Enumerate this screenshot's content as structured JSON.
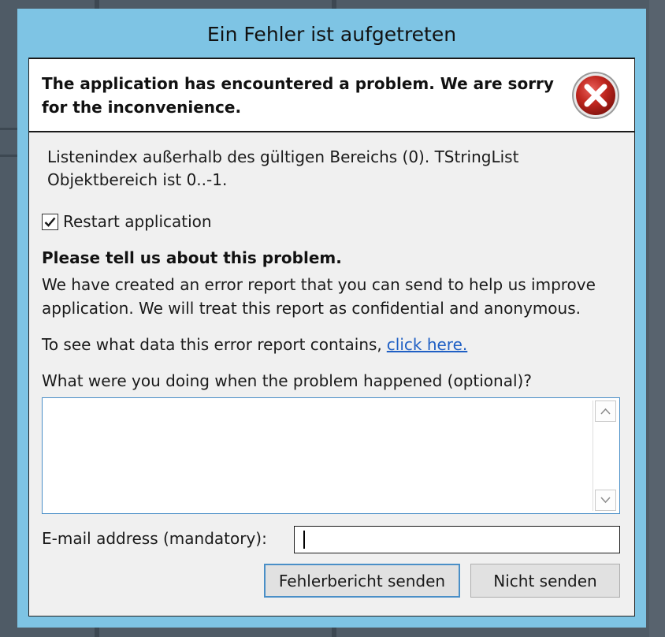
{
  "window": {
    "title": "Ein Fehler ist aufgetreten"
  },
  "header": {
    "text": "The application has encountered a problem. We are sorry for the inconvenience.",
    "icon": "error-icon"
  },
  "message": "Listenindex außerhalb des gültigen Bereichs (0). TStringList Objektbereich ist 0..-1.",
  "restart": {
    "label": "Restart application",
    "checked": true
  },
  "feedback": {
    "heading": "Please tell us about this problem.",
    "body": "We have created an error report that you can send to help us improve application. We will treat this report as confidential and anonymous.",
    "data_prefix": "To see what data this error report contains,",
    "data_link": "click here.",
    "doing_label": "What were you doing when the problem happened (optional)?",
    "doing_value": ""
  },
  "email": {
    "label": "E-mail address (mandatory):",
    "value": ""
  },
  "buttons": {
    "send": "Fehlerbericht senden",
    "dont_send": "Nicht senden"
  },
  "colors": {
    "title_bar": "#7ec4e4",
    "link": "#1f5fc4",
    "error_red": "#c62828",
    "focus_border": "#4a8fc7"
  }
}
